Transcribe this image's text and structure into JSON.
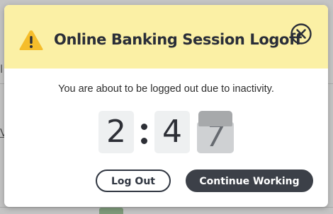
{
  "background": {
    "fragments": [
      "l",
      "V"
    ]
  },
  "modal": {
    "title": "Online Banking Session Logoff",
    "warning_icon": "warning-icon",
    "close_icon": "close-icon",
    "message": "You are about to be logged out due to inactivity.",
    "countdown": {
      "minutes": "2",
      "seconds_tens": "4",
      "seconds_ones": "7"
    },
    "buttons": {
      "logout_label": "Log Out",
      "continue_label": "Continue Working"
    }
  },
  "colors": {
    "header_bg": "#fbf0a5",
    "warning_icon": "#f5bd2b",
    "primary_button": "#3c4048",
    "title_text": "#2a2e38"
  }
}
